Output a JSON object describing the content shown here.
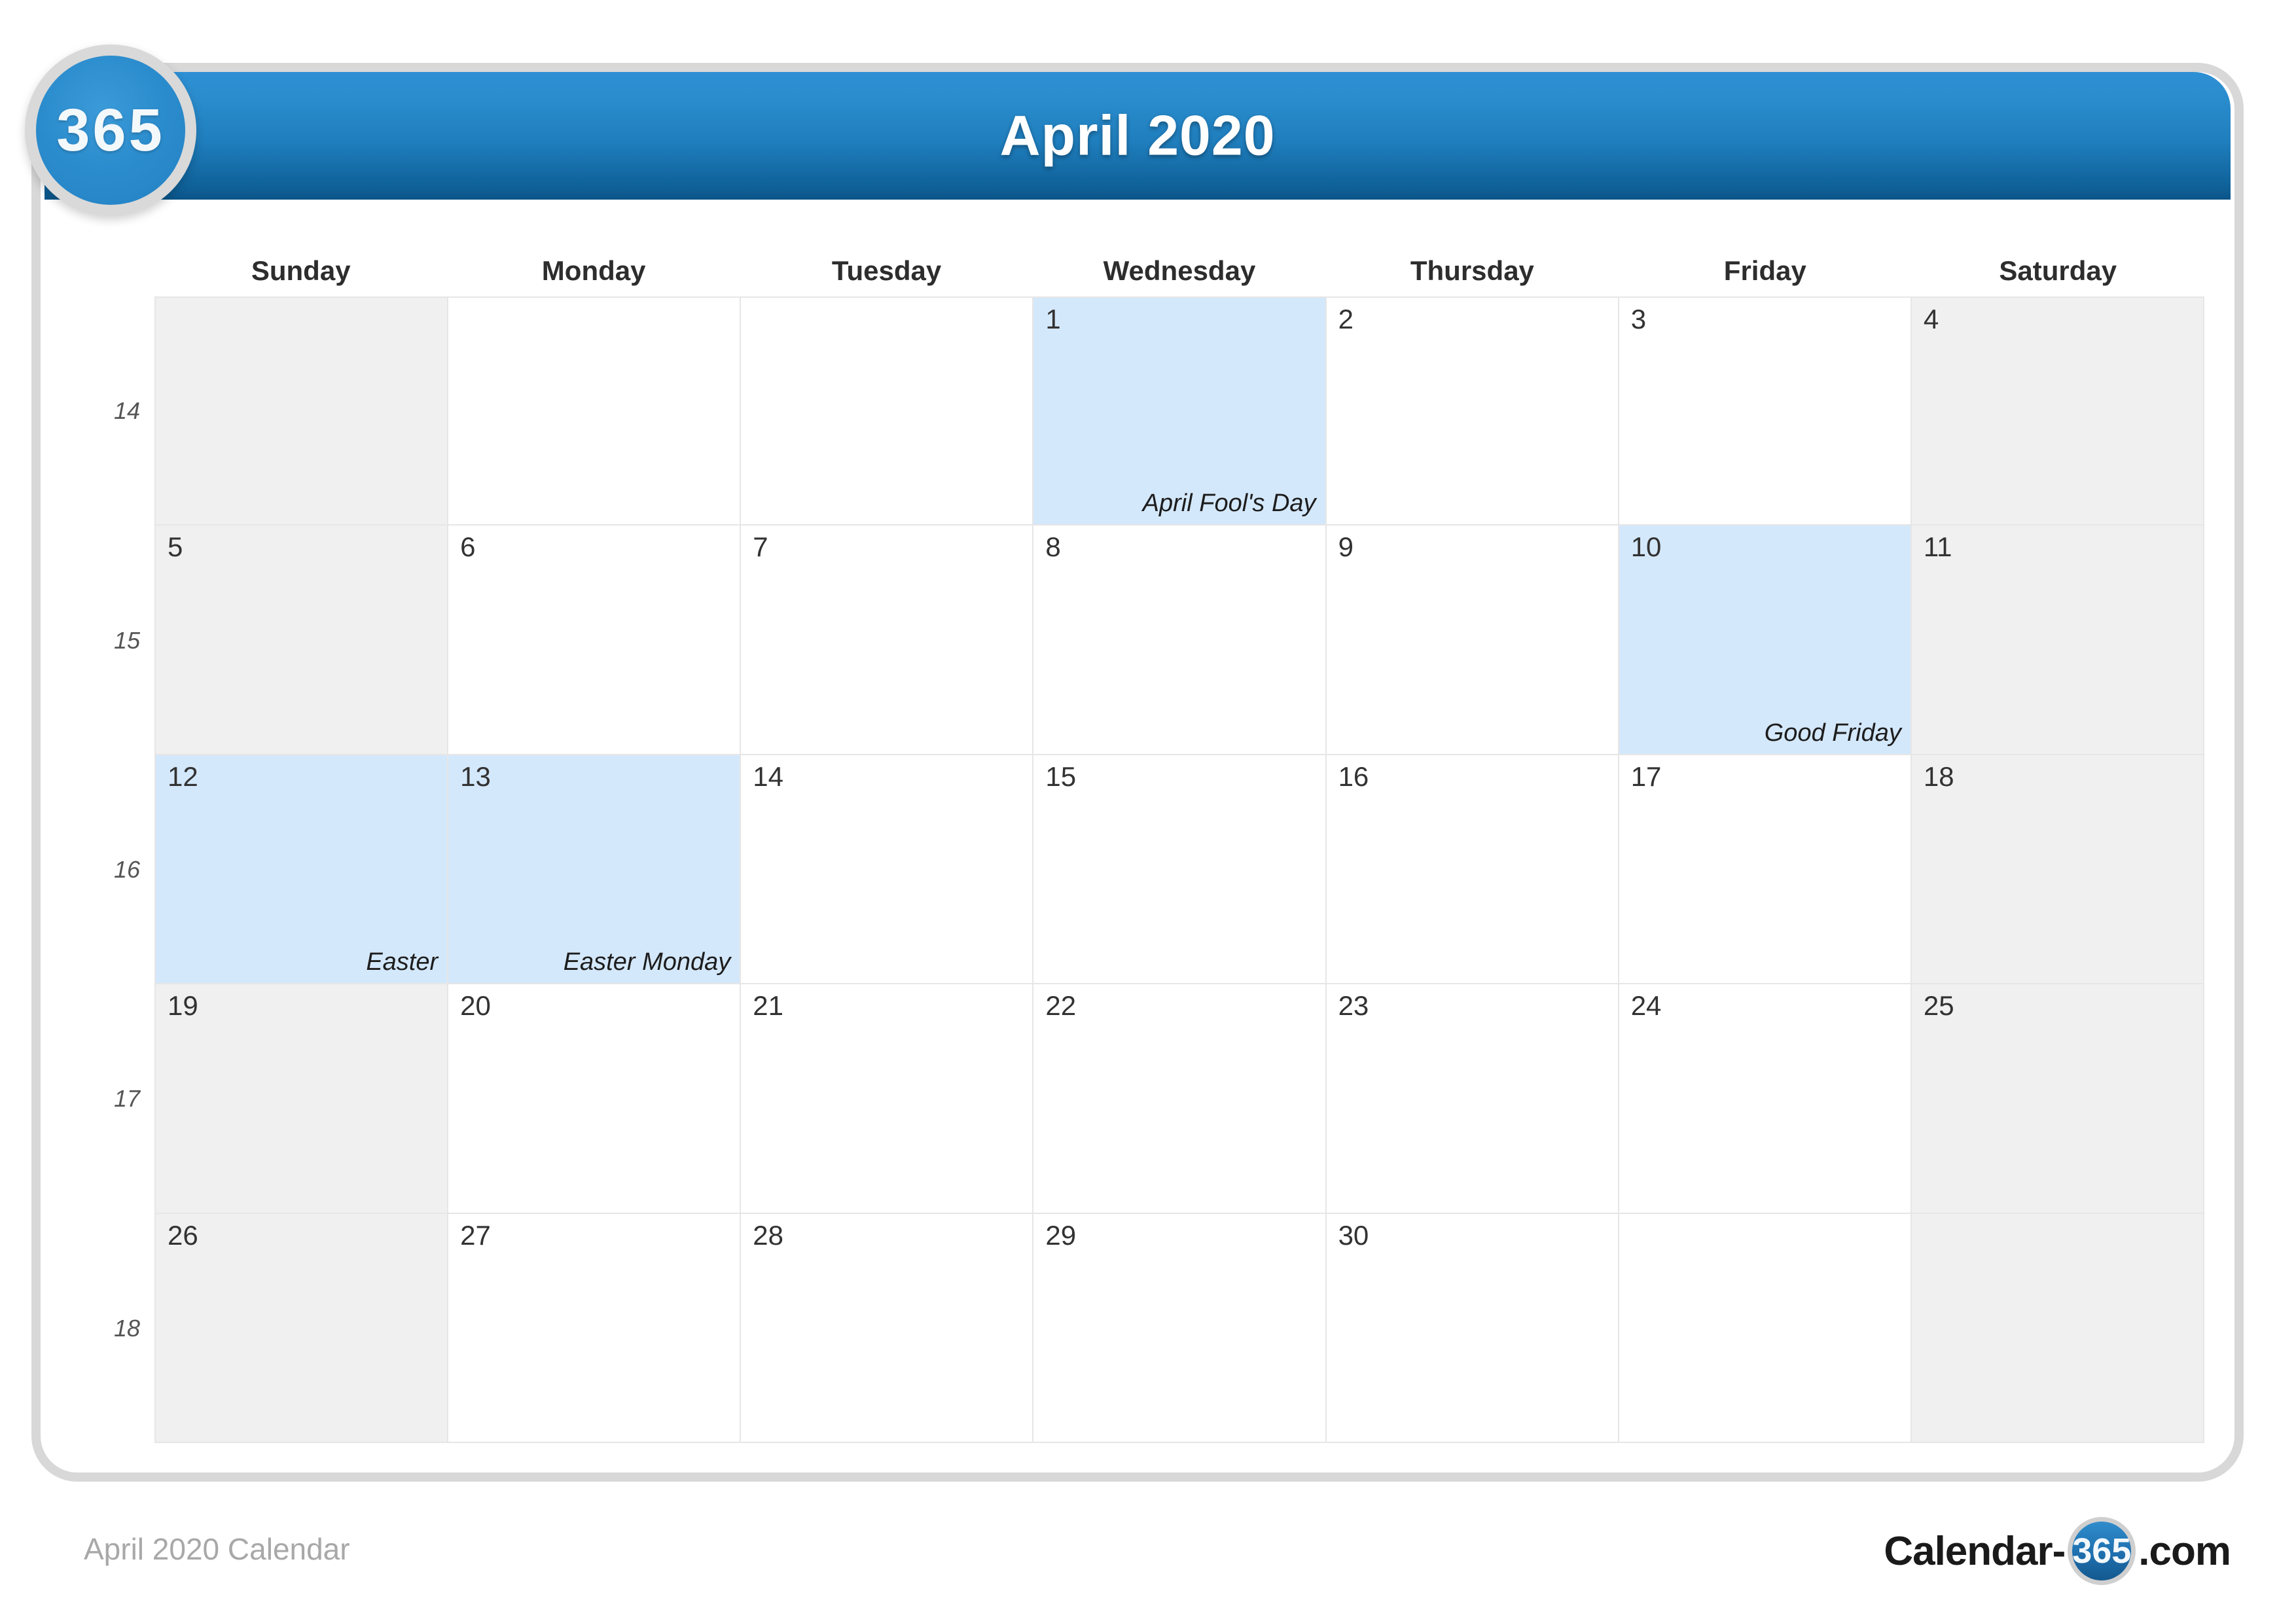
{
  "brand": {
    "badge_label": "365",
    "logo_prefix": "Calendar-",
    "logo_circle": "365",
    "logo_suffix": ".com"
  },
  "header": {
    "title": "April 2020"
  },
  "watermark": {
    "text": "365"
  },
  "footer": {
    "caption": "April 2020 Calendar"
  },
  "weekdays": [
    "Sunday",
    "Monday",
    "Tuesday",
    "Wednesday",
    "Thursday",
    "Friday",
    "Saturday"
  ],
  "colors": {
    "header_blue": "#1f7ebd",
    "highlight_blue": "#d4e8fb",
    "weekend_gray": "#f0f0f0",
    "grid_line": "#e6e6e6",
    "badge_blue": "#2b8ccd"
  },
  "weeks": [
    {
      "week_number": "14",
      "days": [
        {
          "date": "",
          "event": "",
          "highlight": false,
          "weekend": true,
          "blank": true
        },
        {
          "date": "",
          "event": "",
          "highlight": false,
          "weekend": false,
          "blank": true
        },
        {
          "date": "",
          "event": "",
          "highlight": false,
          "weekend": false,
          "blank": true
        },
        {
          "date": "1",
          "event": "April Fool's Day",
          "highlight": true,
          "weekend": false,
          "blank": false
        },
        {
          "date": "2",
          "event": "",
          "highlight": false,
          "weekend": false,
          "blank": false
        },
        {
          "date": "3",
          "event": "",
          "highlight": false,
          "weekend": false,
          "blank": false
        },
        {
          "date": "4",
          "event": "",
          "highlight": false,
          "weekend": true,
          "blank": false
        }
      ]
    },
    {
      "week_number": "15",
      "days": [
        {
          "date": "5",
          "event": "",
          "highlight": false,
          "weekend": true,
          "blank": false
        },
        {
          "date": "6",
          "event": "",
          "highlight": false,
          "weekend": false,
          "blank": false
        },
        {
          "date": "7",
          "event": "",
          "highlight": false,
          "weekend": false,
          "blank": false
        },
        {
          "date": "8",
          "event": "",
          "highlight": false,
          "weekend": false,
          "blank": false
        },
        {
          "date": "9",
          "event": "",
          "highlight": false,
          "weekend": false,
          "blank": false
        },
        {
          "date": "10",
          "event": "Good Friday",
          "highlight": true,
          "weekend": false,
          "blank": false
        },
        {
          "date": "11",
          "event": "",
          "highlight": false,
          "weekend": true,
          "blank": false
        }
      ]
    },
    {
      "week_number": "16",
      "days": [
        {
          "date": "12",
          "event": "Easter",
          "highlight": true,
          "weekend": true,
          "blank": false
        },
        {
          "date": "13",
          "event": "Easter Monday",
          "highlight": true,
          "weekend": false,
          "blank": false
        },
        {
          "date": "14",
          "event": "",
          "highlight": false,
          "weekend": false,
          "blank": false
        },
        {
          "date": "15",
          "event": "",
          "highlight": false,
          "weekend": false,
          "blank": false
        },
        {
          "date": "16",
          "event": "",
          "highlight": false,
          "weekend": false,
          "blank": false
        },
        {
          "date": "17",
          "event": "",
          "highlight": false,
          "weekend": false,
          "blank": false
        },
        {
          "date": "18",
          "event": "",
          "highlight": false,
          "weekend": true,
          "blank": false
        }
      ]
    },
    {
      "week_number": "17",
      "days": [
        {
          "date": "19",
          "event": "",
          "highlight": false,
          "weekend": true,
          "blank": false
        },
        {
          "date": "20",
          "event": "",
          "highlight": false,
          "weekend": false,
          "blank": false
        },
        {
          "date": "21",
          "event": "",
          "highlight": false,
          "weekend": false,
          "blank": false
        },
        {
          "date": "22",
          "event": "",
          "highlight": false,
          "weekend": false,
          "blank": false
        },
        {
          "date": "23",
          "event": "",
          "highlight": false,
          "weekend": false,
          "blank": false
        },
        {
          "date": "24",
          "event": "",
          "highlight": false,
          "weekend": false,
          "blank": false
        },
        {
          "date": "25",
          "event": "",
          "highlight": false,
          "weekend": true,
          "blank": false
        }
      ]
    },
    {
      "week_number": "18",
      "days": [
        {
          "date": "26",
          "event": "",
          "highlight": false,
          "weekend": true,
          "blank": false
        },
        {
          "date": "27",
          "event": "",
          "highlight": false,
          "weekend": false,
          "blank": false
        },
        {
          "date": "28",
          "event": "",
          "highlight": false,
          "weekend": false,
          "blank": false
        },
        {
          "date": "29",
          "event": "",
          "highlight": false,
          "weekend": false,
          "blank": false
        },
        {
          "date": "30",
          "event": "",
          "highlight": false,
          "weekend": false,
          "blank": false
        },
        {
          "date": "",
          "event": "",
          "highlight": false,
          "weekend": false,
          "blank": true
        },
        {
          "date": "",
          "event": "",
          "highlight": false,
          "weekend": true,
          "blank": true
        }
      ]
    }
  ]
}
